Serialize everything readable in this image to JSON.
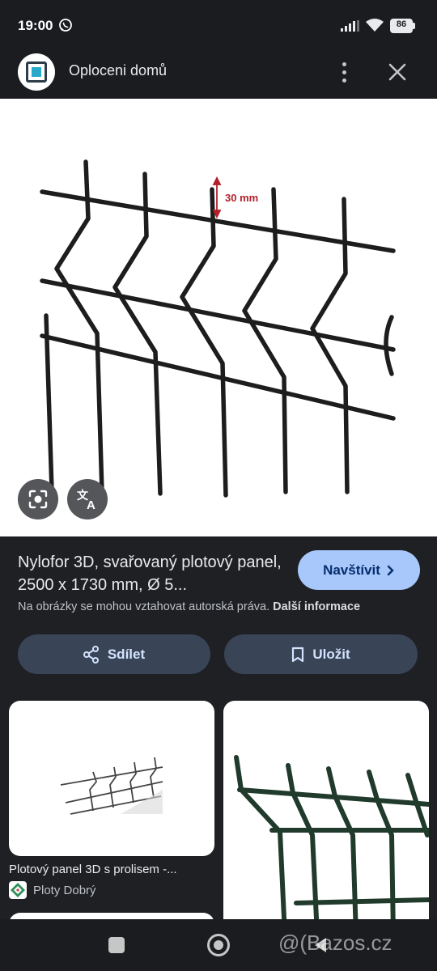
{
  "status_bar": {
    "time": "19:00",
    "battery_level": "86",
    "icons": [
      "whatsapp-icon",
      "signal-icon",
      "wifi-icon",
      "battery-icon"
    ]
  },
  "app_bar": {
    "title": "Oploceni domů",
    "icons": [
      "site-logo-icon",
      "more-vert-icon",
      "close-icon"
    ]
  },
  "image_overlay": {
    "dimension_label": "30 mm",
    "buttons": [
      "lens-icon",
      "translate-icon"
    ]
  },
  "result": {
    "title": "Nylofor 3D, svařovaný plotový panel, 2500 x 1730 mm, Ø 5...",
    "visit_label": "Navštívit",
    "copyright_text": "Na obrázky se mohou vztahovat autorská práva.",
    "more_info_label": "Další informace"
  },
  "actions": {
    "share_label": "Sdílet",
    "save_label": "Uložit"
  },
  "related": [
    {
      "caption": "Plotový panel 3D s prolisem -...",
      "source": "Ploty Dobrý"
    },
    {
      "caption": "",
      "source": ""
    }
  ],
  "watermark": "@(Bazos.cz",
  "colors": {
    "background": "#1f2024",
    "accent_button": "#a8c7fa",
    "tonal_button": "#394457",
    "dimension_red": "#b3202a"
  }
}
